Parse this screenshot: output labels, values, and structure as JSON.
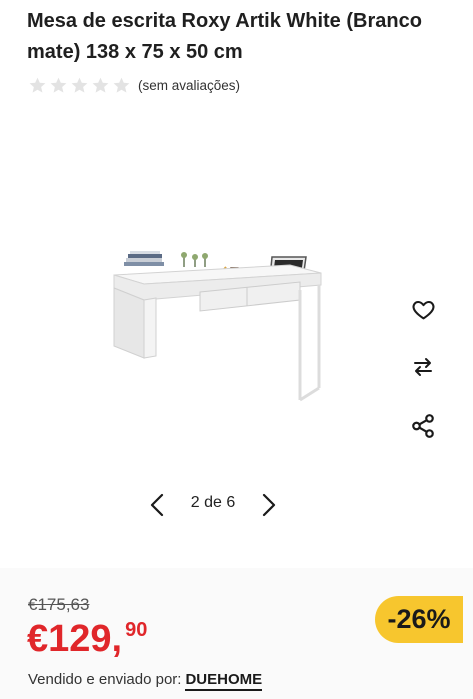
{
  "product": {
    "title": "Mesa de escrita Roxy Artik White (Branco mate) 138 x 75 x 50 cm",
    "rating_text": "(sem avaliações)",
    "stars": 0,
    "stars_max": 5
  },
  "gallery": {
    "pager_label": "2 de 6",
    "actions": [
      {
        "icon": "heart-icon"
      },
      {
        "icon": "compare-arrows-icon"
      },
      {
        "icon": "share-icon"
      }
    ]
  },
  "price": {
    "old": "€175,63",
    "main": "€129,",
    "cents": "90",
    "discount": "-26%"
  },
  "seller": {
    "prefix": "Vendido e enviado por:",
    "name": "DUEHOME"
  },
  "colors": {
    "price_red": "#e0262a",
    "badge_yellow": "#f7c62e",
    "star_empty": "#e3e3e3"
  }
}
